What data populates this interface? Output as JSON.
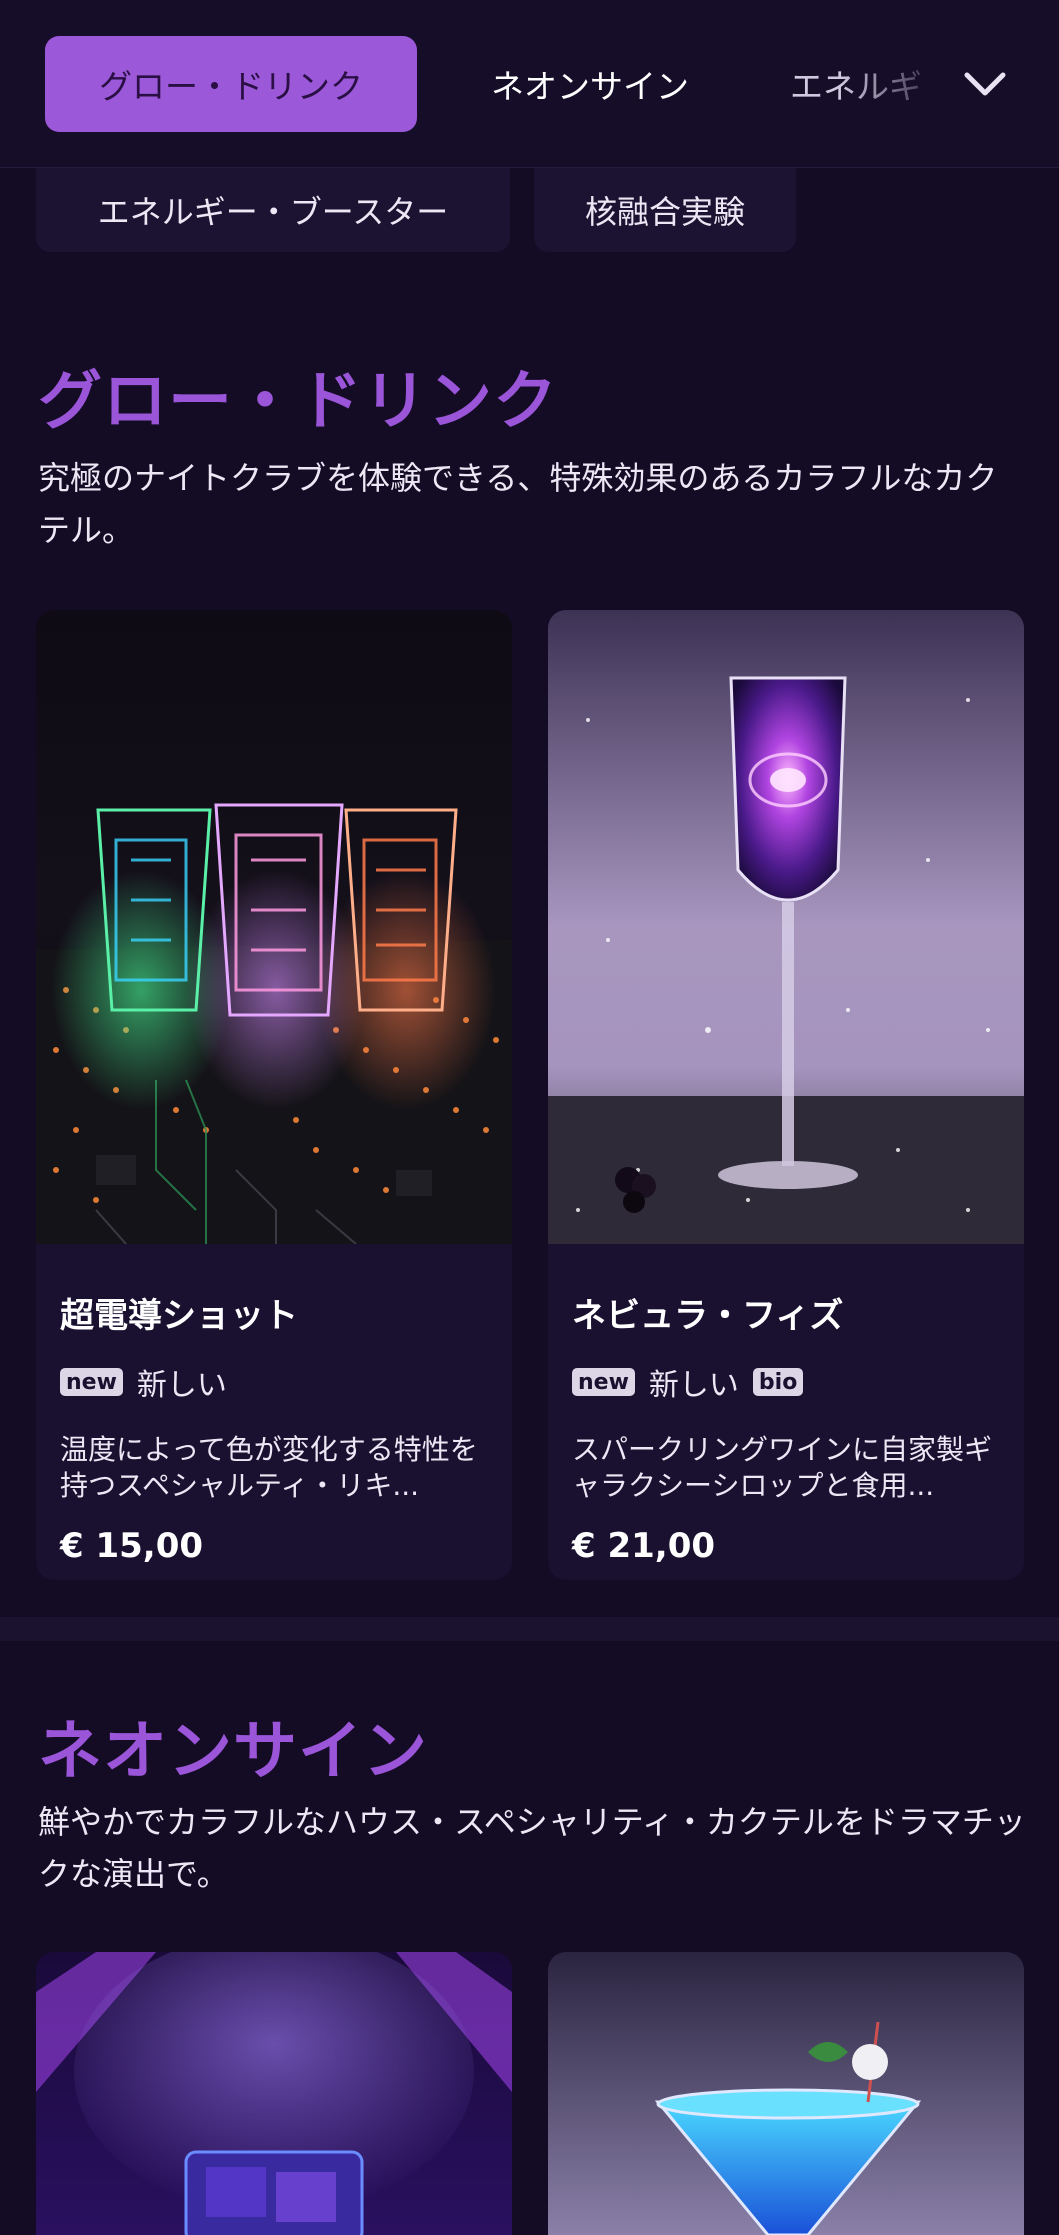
{
  "tabs": [
    {
      "label": "グロー・ドリンク",
      "active": true
    },
    {
      "label": "ネオンサイン",
      "active": false
    },
    {
      "label": "エネルギ",
      "active": false
    }
  ],
  "tab_more_icon": "chevron-down-icon",
  "chips": [
    {
      "label": "エネルギー・ブースター"
    },
    {
      "label": "核融合実験"
    }
  ],
  "sections": [
    {
      "title": "グロー・ドリンク",
      "description": "究極のナイトクラブを体験できる、特殊効果のあるカラフルなカクテル。",
      "items": [
        {
          "name": "超電導ショット",
          "badges": [
            {
              "type": "new",
              "label": "new",
              "text": "新しい"
            }
          ],
          "description": "温度によって色が変化する特性を持つスペシャルティ・リキ...",
          "price": "€ 15,00"
        },
        {
          "name": "ネビュラ・フィズ",
          "badges": [
            {
              "type": "new",
              "label": "new",
              "text": "新しい"
            },
            {
              "type": "bio",
              "label": "bio"
            }
          ],
          "description": "スパークリングワインに自家製ギャラクシーシロップと食用...",
          "price": "€ 21,00"
        }
      ]
    },
    {
      "title": "ネオンサイン",
      "description": "鮮やかでカラフルなハウス・スペシャリティ・カクテルをドラマチックな演出で。"
    }
  ],
  "colors": {
    "background": "#140b25",
    "accent": "#9b59d9",
    "title_purple": "#9a55d8",
    "card_bg": "#1a1030"
  }
}
